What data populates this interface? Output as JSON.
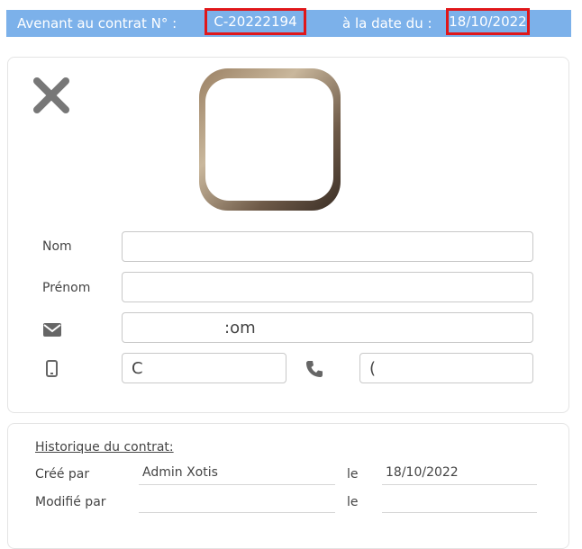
{
  "header": {
    "contract_label": "Avenant au contrat N° :",
    "contract_number": "C-20222194",
    "date_label": "à la date du :",
    "date_value": "18/10/2022"
  },
  "contact": {
    "nom_label": "Nom",
    "nom_value": "",
    "prenom_label": "Prénom",
    "prenom_value": "",
    "email_value": ":om",
    "mobile_value": "C",
    "phone_value": "("
  },
  "history": {
    "title": "Historique du contrat:",
    "created_by_label": "Créé par",
    "created_by_value": "Admin Xotis",
    "created_le_label": "le",
    "created_date": "18/10/2022",
    "modified_by_label": "Modifié par",
    "modified_by_value": "",
    "modified_le_label": "le",
    "modified_date": ""
  },
  "icons": {
    "close": "close-icon",
    "email": "email-icon",
    "mobile": "mobile-icon",
    "phone": "phone-icon"
  },
  "colors": {
    "header_bg": "#7cb1ea",
    "highlight_border": "#e0171a"
  }
}
